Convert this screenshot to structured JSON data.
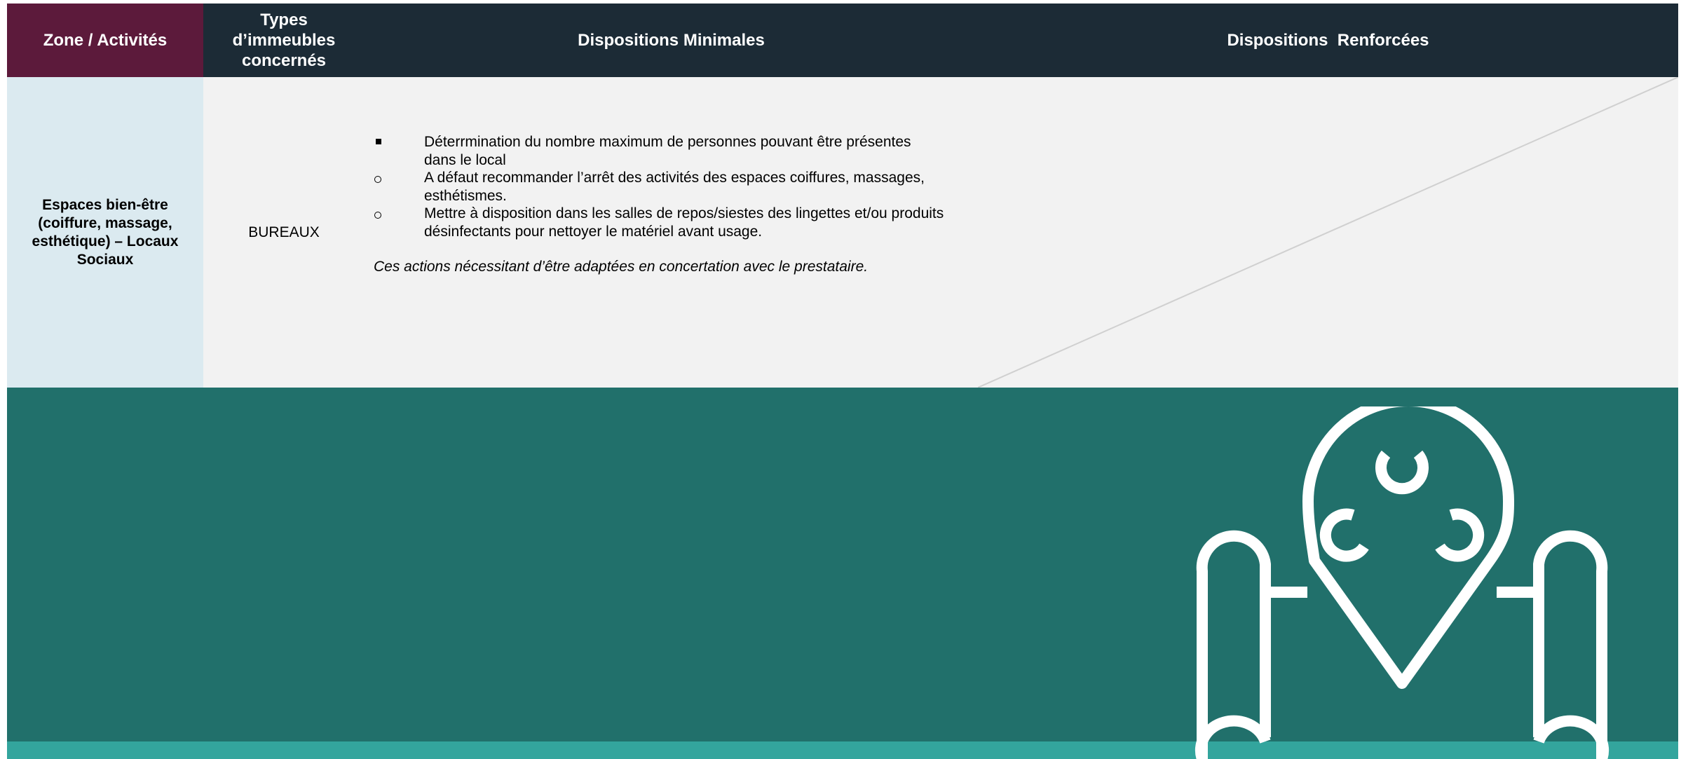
{
  "header": {
    "zone": "Zone / Activités",
    "types_line1": "Types",
    "types_line2": "d’immeubles",
    "types_line3": "concernés",
    "minimal": "Dispositions Minimales",
    "renforcees": "Dispositions  Renforcées"
  },
  "row": {
    "zone_line1": "Espaces bien-être",
    "zone_line2": "(coiffure, massage,",
    "zone_line3": "esthétique) – Locaux",
    "zone_line4": "Sociaux",
    "type": "BUREAUX",
    "minimal": {
      "items": [
        {
          "line1": "Déterrmination du nombre maximum de personnes pouvant être présentes",
          "line2": "dans le local"
        },
        {
          "line1": "A défaut recommander l’arrêt des activités des espaces coiffures, massages,",
          "line2": "esthétismes."
        },
        {
          "line1": "Mettre à disposition dans les salles de repos/siestes des lingettes et/ou produits",
          "line2": "désinfectants pour nettoyer le matériel avant usage."
        }
      ],
      "note": "Ces actions nécessitant d’être adaptées en concertation avec le prestataire."
    }
  },
  "colors": {
    "zone_header": "#5c1a3b",
    "header": "#1c2b36",
    "zone_cell": "#dbeaf0",
    "content_cell": "#f2f2f2",
    "teal": "#21706b",
    "teal_light": "#33a59d"
  },
  "icons": {
    "emblem": "biohazard-location-scroll-icon",
    "bullet_first": "square-bullet-icon",
    "bullet_other": "circle-bullet-icon"
  }
}
